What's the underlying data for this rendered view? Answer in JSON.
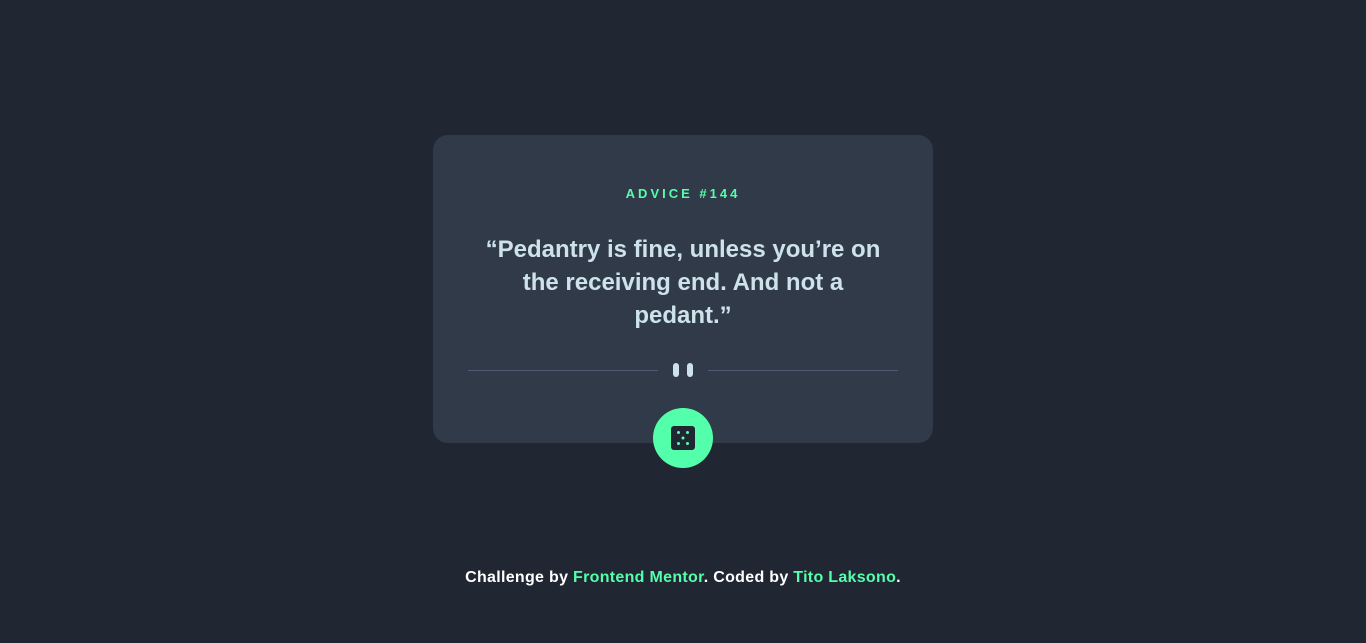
{
  "card": {
    "advice_id": "ADVICE #144",
    "quote": "“Pedantry is fine, unless you’re on the receiving end. And not a pedant.”",
    "divider_icon": "pause-icon",
    "dice_button_icon": "dice-icon"
  },
  "footer": {
    "prefix": "Challenge by ",
    "challenge_link": "Frontend Mentor",
    "middle": ". Coded by ",
    "author_link": "Tito Laksono",
    "suffix": "."
  },
  "colors": {
    "background": "#202632",
    "card": "#313a48",
    "accent": "#53ffab",
    "quote_text": "#cee3e9",
    "divider": "#4f5d74"
  }
}
